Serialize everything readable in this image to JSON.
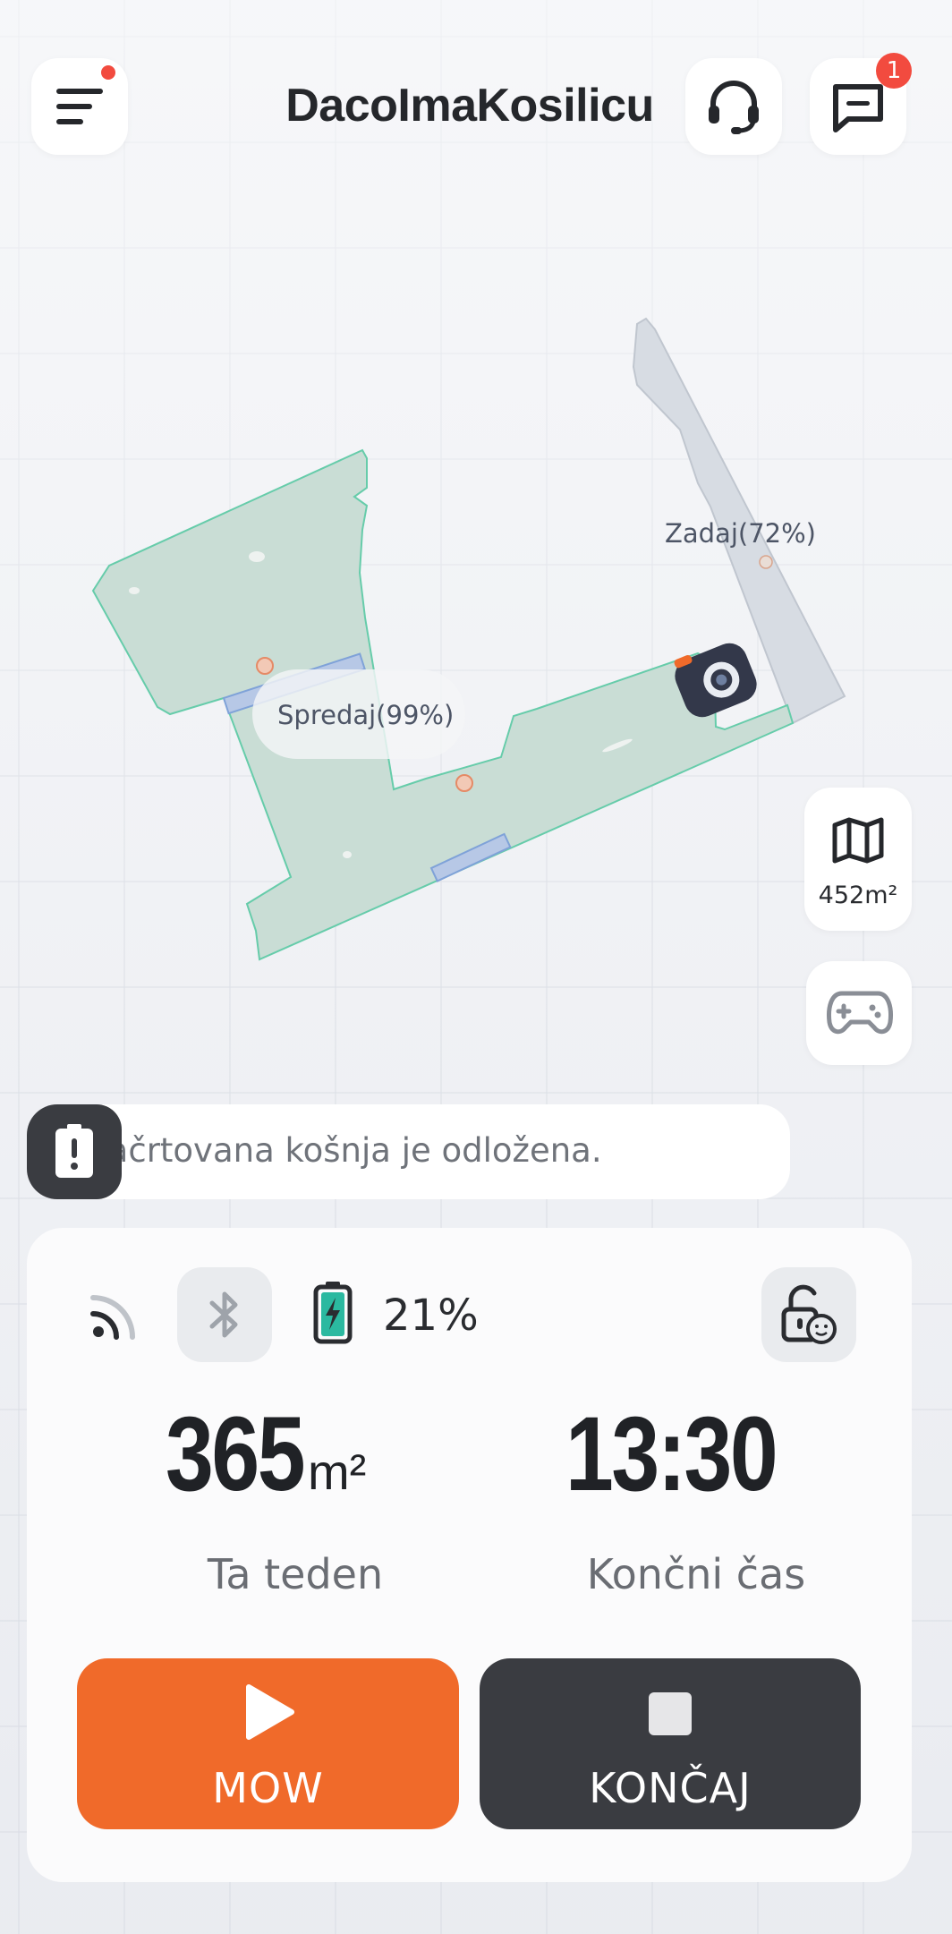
{
  "header": {
    "title": "DacoImaKosilicu",
    "menu_icon": "menu-icon",
    "support_icon": "headset-icon",
    "messages_icon": "message-icon",
    "messages_badge": "1"
  },
  "map": {
    "zones": [
      {
        "name": "Spredaj(99%)"
      },
      {
        "name": "Zadaj(72%)"
      }
    ],
    "area_button": {
      "icon": "map-icon",
      "value": "452m²"
    },
    "joystick_icon": "gamepad-icon"
  },
  "notice": {
    "icon": "alert-battery-icon",
    "text": "Načrtovana košnja je odložena."
  },
  "status": {
    "wifi_icon": "wifi-icon",
    "bluetooth_icon": "bluetooth-icon",
    "battery_icon": "battery-charging-icon",
    "battery_percent": "21%",
    "lock_icon": "child-lock-icon"
  },
  "stats": {
    "area_value": "365",
    "area_unit": "m²",
    "area_label": "Ta teden",
    "end_time_value": "13:30",
    "end_time_label": "Končni čas"
  },
  "actions": {
    "mow_label": "MOW",
    "stop_label": "KONČAJ"
  },
  "colors": {
    "accent": "#f06a2a",
    "dark": "#3a3c41",
    "lawn_fill": "#c9ddd5",
    "lawn_border": "#66ccaa",
    "badge": "#f24b3f"
  }
}
